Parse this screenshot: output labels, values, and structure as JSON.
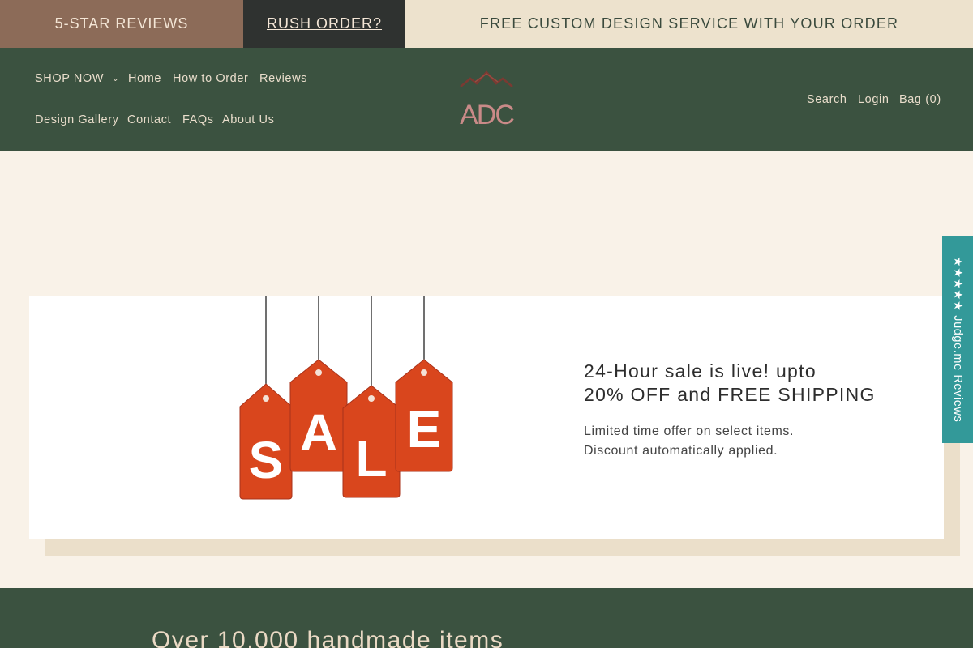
{
  "announcement": {
    "reviews_label": "5-STAR REVIEWS",
    "rush_label": "RUSH ORDER?",
    "free_design_label": "FREE CUSTOM DESIGN SERVICE WITH YOUR ORDER"
  },
  "nav": {
    "shop_now": "SHOP NOW",
    "home": "Home",
    "how_to_order": "How to Order",
    "reviews": "Reviews",
    "design_gallery": "Design Gallery",
    "contact": "Contact",
    "faqs": "FAQs",
    "about_us": "About Us"
  },
  "logo": {
    "text": "ADC"
  },
  "header_utils": {
    "search": "Search",
    "login": "Login",
    "bag": "Bag (0)"
  },
  "promo": {
    "sale_letters": [
      "S",
      "A",
      "L",
      "E"
    ],
    "title_line1": "24-Hour sale is live! upto",
    "title_line2": "20% OFF and FREE SHIPPING",
    "text_line1": "Limited time offer on select items.",
    "text_line2": "Discount automatically applied."
  },
  "reviews_tab": {
    "label": "★★★★★ Judge.me Reviews"
  },
  "section": {
    "heading": "Over 10,000 handmade items"
  },
  "colors": {
    "header_green": "#3b5240",
    "cream": "#f9f2e8",
    "brown": "#8c6b58",
    "charcoal": "#2f3230",
    "tag_orange": "#d9461d",
    "review_teal": "#339999"
  }
}
